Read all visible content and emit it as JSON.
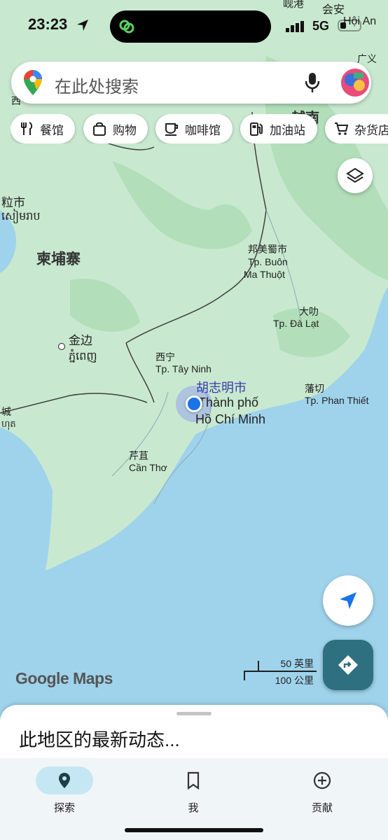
{
  "status_bar": {
    "time": "23:23",
    "network": "5G"
  },
  "search": {
    "placeholder": "在此处搜索"
  },
  "chips": [
    {
      "label": "餐馆",
      "icon": "restaurant-icon"
    },
    {
      "label": "购物",
      "icon": "shopping-bag-icon"
    },
    {
      "label": "咖啡馆",
      "icon": "coffee-icon"
    },
    {
      "label": "加油站",
      "icon": "gas-station-icon"
    },
    {
      "label": "杂货店",
      "icon": "cart-icon"
    }
  ],
  "map": {
    "labels": {
      "cambodia": "柬埔寨",
      "phnom_penh_cn": "金边",
      "phnom_penh_km": "ភ្នំពេញ",
      "hcmc_cn": "胡志明市",
      "hcmc_vi_1": "Thành phố",
      "hcmc_vi_2": "Hồ Chí Minh",
      "tay_ninh_cn": "西宁",
      "tay_ninh_vi": "Tp. Tây Ninh",
      "can_tho_cn": "芹苴",
      "can_tho_vi": "Cần Thơ",
      "buon_cn": "邦美蜀市",
      "buon_vi_1": "Tp. Buôn",
      "buon_vi_2": "Ma Thuột",
      "dalat_cn": "大叻",
      "dalat_vi": "Tp. Đà Lạt",
      "phanthiet_cn": "藩切",
      "phanthiet_vi": "Tp. Phan Thiết",
      "hoian_cn": "会安",
      "hoian_vi": "Hội An",
      "danang_cn": "岘港",
      "siem_cn": "粒市",
      "siem_km": "សៀមរាប",
      "kampot_cn": "城",
      "kampot_km": "ហុត",
      "quang_cn": "广义",
      "vietnam_partial": "越南",
      "laos_partial": "西"
    }
  },
  "scale": {
    "imperial": "50 英里",
    "metric": "100 公里"
  },
  "attribution": "Google Maps",
  "sheet": {
    "title": "此地区的最新动态..."
  },
  "nav": [
    {
      "label": "探索",
      "icon": "explore-pin-icon",
      "active": true
    },
    {
      "label": "我",
      "icon": "bookmark-icon",
      "active": false
    },
    {
      "label": "贡献",
      "icon": "add-circle-icon",
      "active": false
    }
  ],
  "colors": {
    "water": "#9fd3ec",
    "land": "#c8e9cf",
    "accent": "#2f7080",
    "location": "#1a73e8"
  }
}
